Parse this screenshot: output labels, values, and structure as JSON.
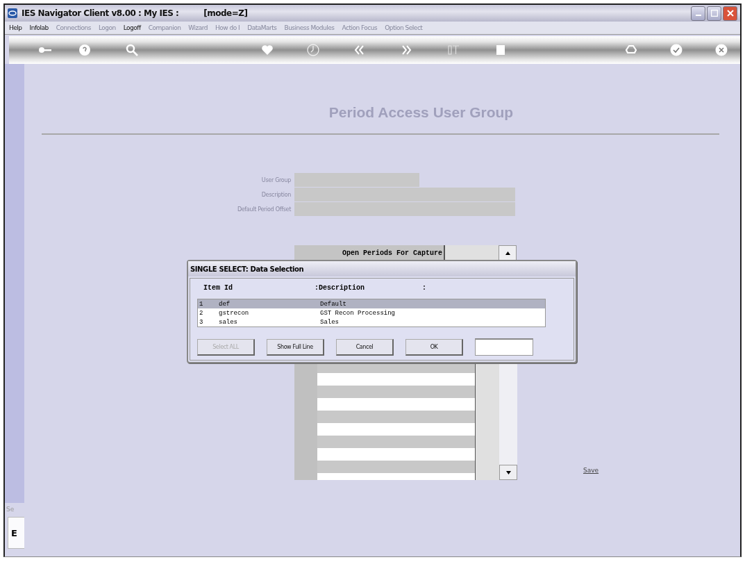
{
  "window": {
    "title": "IES Navigator Client v8.00 : My IES :",
    "mode": "[mode=Z]"
  },
  "menu": [
    {
      "label": "Help",
      "disabled": false
    },
    {
      "label": "Infolab",
      "disabled": false
    },
    {
      "label": "Connections",
      "disabled": true
    },
    {
      "label": "Logon",
      "disabled": true
    },
    {
      "label": "Logoff",
      "disabled": false
    },
    {
      "label": "Companion",
      "disabled": true
    },
    {
      "label": "Wizard",
      "disabled": true
    },
    {
      "label": "How do I",
      "disabled": true
    },
    {
      "label": "DataMarts",
      "disabled": true
    },
    {
      "label": "Business Modules",
      "disabled": true
    },
    {
      "label": "Action Focus",
      "disabled": true
    },
    {
      "label": "Option Select",
      "disabled": true
    }
  ],
  "page": {
    "title": "Period Access User Group"
  },
  "form": {
    "fields": [
      {
        "label": "User Group",
        "kind": "short"
      },
      {
        "label": "Description",
        "kind": "long"
      },
      {
        "label": "Default Period Offset",
        "kind": "long"
      }
    ]
  },
  "grid": {
    "header": "Open Periods For Capture"
  },
  "dialog": {
    "title": "SINGLE SELECT: Data Selection",
    "columns": [
      "Item Id",
      ":Description",
      ":"
    ],
    "rows": [
      {
        "index": "1",
        "id": "def",
        "description": "Default",
        "selected": true
      },
      {
        "index": "2",
        "id": "gstrecon",
        "description": "GST Recon Processing",
        "selected": false
      },
      {
        "index": "3",
        "id": "sales",
        "description": "Sales",
        "selected": false
      }
    ],
    "buttons": [
      {
        "label": "Select ALL",
        "disabled": true
      },
      {
        "label": "Show Full Line",
        "disabled": false
      },
      {
        "label": "Cancel",
        "disabled": false
      },
      {
        "label": "OK",
        "disabled": false
      }
    ]
  },
  "save_link": "Save",
  "status": {
    "label": "Se",
    "value": "E"
  }
}
